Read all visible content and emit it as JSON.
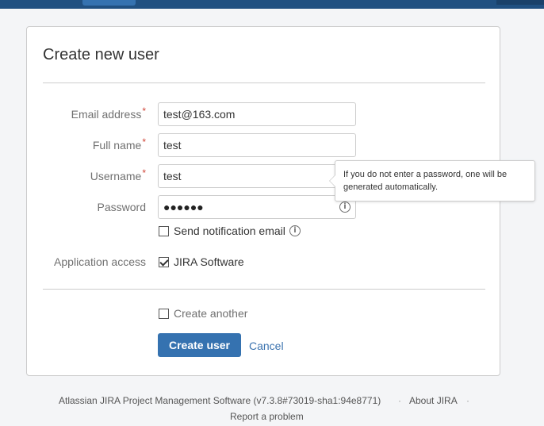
{
  "form": {
    "title": "Create new user",
    "required_marker": "*",
    "email": {
      "label": "Email address",
      "value": "test@163.com"
    },
    "fullname": {
      "label": "Full name",
      "value": "test"
    },
    "username": {
      "label": "Username",
      "value": "test"
    },
    "password": {
      "label": "Password",
      "masked_value": "●●●●●●"
    },
    "password_tooltip": "If you do not enter a password, one will be generated automatically.",
    "send_notification": {
      "label": "Send notification email",
      "checked": false
    },
    "application_access": {
      "label": "Application access",
      "option": "JIRA Software",
      "checked": true
    },
    "create_another": {
      "label": "Create another",
      "checked": false
    },
    "submit_label": "Create user",
    "cancel_label": "Cancel"
  },
  "footer": {
    "product": "Atlassian JIRA Project Management Software (v7.3.8#73019-sha1:94e8771)",
    "separator": "·",
    "about": "About JIRA",
    "report": "Report a problem"
  },
  "icons": {
    "info": "info-icon"
  },
  "colors": {
    "primary_button": "#3572b0",
    "link": "#3b73af",
    "required": "#d04437",
    "topbar": "#205081"
  }
}
